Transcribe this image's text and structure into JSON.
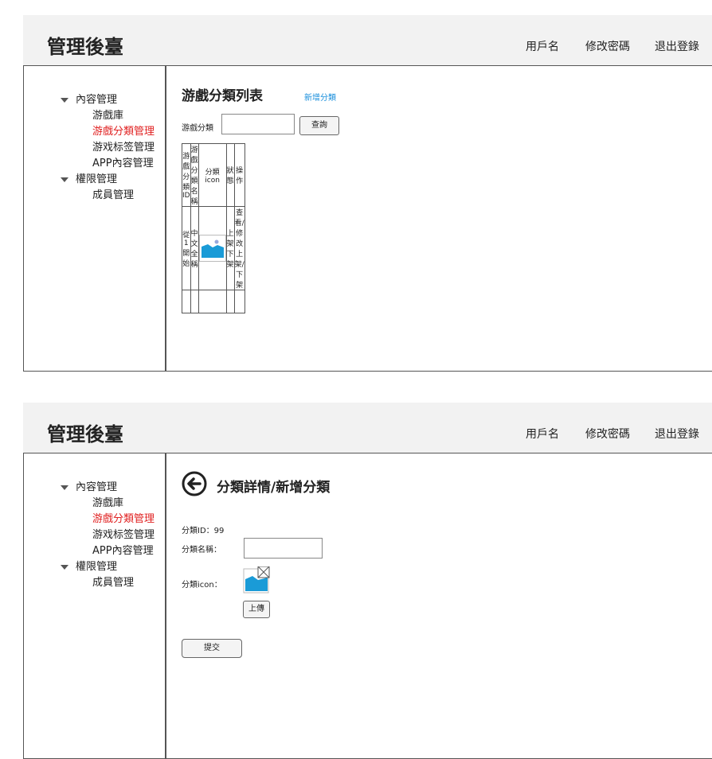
{
  "panel1": {
    "header": {
      "brand": "管理後臺",
      "username": "用戶名",
      "change_password": "修改密碼",
      "logout": "退出登錄"
    },
    "sidebar": {
      "group1": "內容管理",
      "items1": [
        "游戲庫",
        "游戲分類管理",
        "游戏标签管理",
        "APP內容管理"
      ],
      "group2": "權限管理",
      "items2": [
        "成員管理"
      ]
    },
    "main": {
      "title": "游戲分類列表",
      "add_link": "新增分類",
      "query_label": "游戲分類",
      "query_value": "",
      "query_button": "查詢",
      "table": {
        "headers": [
          "游戲分類ID",
          "游戲分類名稱",
          "分類icon",
          "狀態",
          "操作"
        ],
        "row": {
          "id": "從1開始",
          "name": "中文全稱",
          "status_on": "上架",
          "status_off": "下架",
          "action1": "查看/修改",
          "action2": "上架/下架"
        }
      }
    }
  },
  "panel2": {
    "header": {
      "brand": "管理後臺",
      "username": "用戶名",
      "change_password": "修改密碼",
      "logout": "退出登錄"
    },
    "sidebar": {
      "group1": "內容管理",
      "items1": [
        "游戲庫",
        "游戲分類管理",
        "游戏标签管理",
        "APP內容管理"
      ],
      "group2": "權限管理",
      "items2": [
        "成員管理"
      ]
    },
    "main": {
      "title": "分類詳情/新增分類",
      "id_label": "分類ID：99",
      "name_label": "分類名稱：",
      "name_value": "",
      "icon_label": "分類icon：",
      "upload_button": "上傳",
      "submit_button": "提交"
    }
  },
  "colors": {
    "active": "#e02020",
    "link": "#1a8fdc",
    "header_bg": "#f2f2f2",
    "icon_blue": "#1a9bd7"
  },
  "icons": [
    "menu-expand-triangle-icon",
    "image-placeholder-icon",
    "back-arrow-icon",
    "delete-x-icon"
  ]
}
